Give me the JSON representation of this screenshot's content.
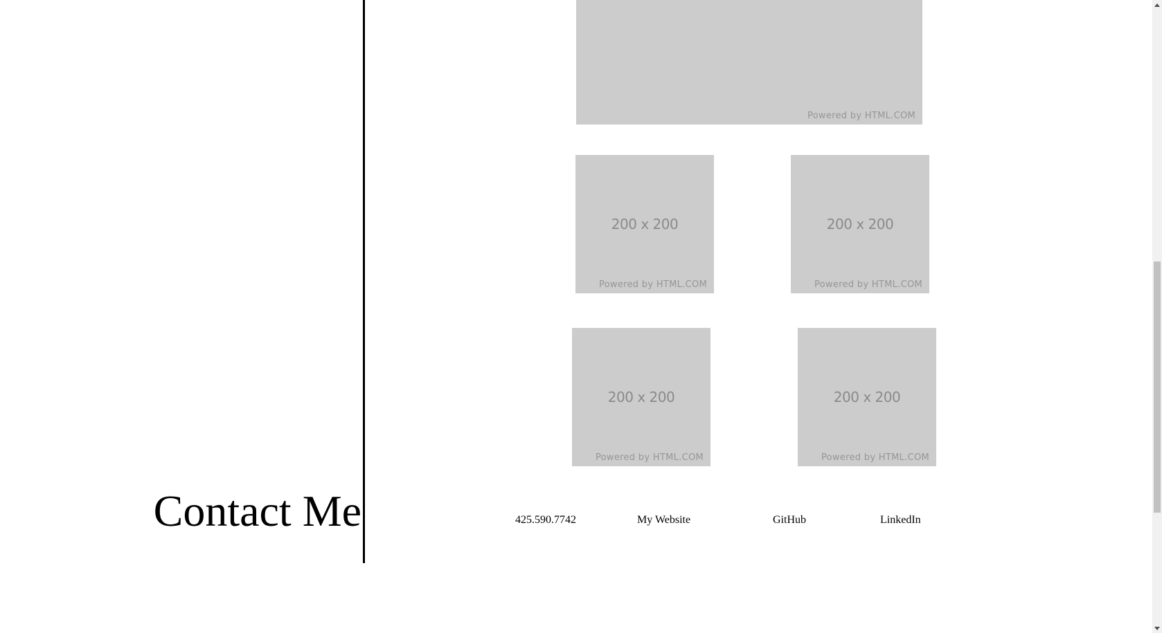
{
  "gallery": {
    "banner": {
      "powered": "Powered by HTML.COM"
    },
    "images": [
      {
        "dim": "200 x 200",
        "powered": "Powered by HTML.COM"
      },
      {
        "dim": "200 x 200",
        "powered": "Powered by HTML.COM"
      },
      {
        "dim": "200 x 200",
        "powered": "Powered by HTML.COM"
      },
      {
        "dim": "200 x 200",
        "powered": "Powered by HTML.COM"
      }
    ]
  },
  "contact": {
    "heading": "Contact Me",
    "links": [
      {
        "label": "425.590.7742"
      },
      {
        "label": "My Website"
      },
      {
        "label": "GitHub"
      },
      {
        "label": "LinkedIn"
      }
    ]
  },
  "colors": {
    "placeholder_bg": "#cccccc",
    "placeholder_text": "#8a8a8a",
    "divider": "#000000",
    "scrollbar_track": "#f1f1f1",
    "scrollbar_thumb": "#c1c1c1"
  },
  "icons": {
    "scroll_up": "scroll-up-arrow-icon",
    "scroll_down": "scroll-down-arrow-icon"
  }
}
